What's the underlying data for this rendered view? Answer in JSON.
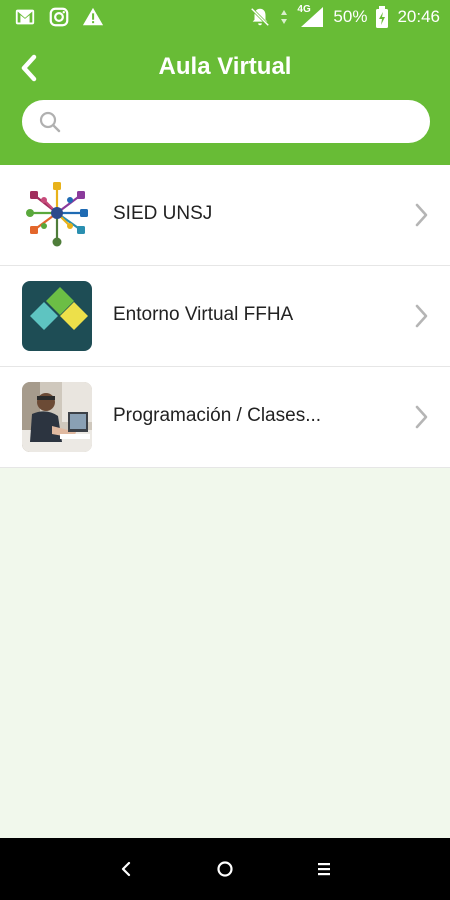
{
  "status_bar": {
    "battery_text": "50%",
    "time": "20:46",
    "network_label": "4G",
    "left_icons": [
      "gmail-icon",
      "instagram-icon",
      "warning-icon"
    ],
    "right_icons": [
      "mute-notifications-icon",
      "signal-icon",
      "battery-icon"
    ]
  },
  "header": {
    "title": "Aula Virtual",
    "back_icon": "chevron-left-icon"
  },
  "search": {
    "placeholder": "",
    "value": "",
    "icon": "search-icon"
  },
  "list": {
    "items": [
      {
        "label": "SIED UNSJ",
        "icon": "sied-network-logo-icon"
      },
      {
        "label": "Entorno Virtual FFHA",
        "icon": "ffha-diamonds-logo-icon"
      },
      {
        "label": "Programación / Clases...",
        "icon": "person-at-laptop-photo"
      }
    ]
  },
  "nav_bar": {
    "buttons": [
      "back-nav-icon",
      "home-nav-icon",
      "recents-nav-icon"
    ]
  },
  "colors": {
    "brand_green": "#68bc36",
    "page_background": "#f1f8ec",
    "text_dark": "#222222",
    "chevron_gray": "#b5b5b5"
  }
}
